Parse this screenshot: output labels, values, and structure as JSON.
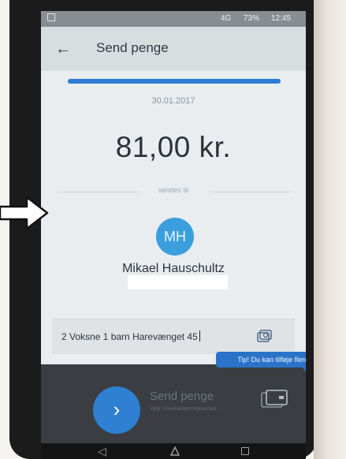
{
  "status_bar": {
    "network": "4G",
    "battery": "73%",
    "time": "12:45"
  },
  "header": {
    "title": "Send penge"
  },
  "transfer": {
    "progress": 1.0,
    "date": "30.01.2017",
    "amount": "81,00 kr.",
    "sent_to_label": "sendes til"
  },
  "recipient": {
    "initials": "MH",
    "name": "Mikael Hauschultz"
  },
  "message": {
    "text": "2 Voksne 1 barn Harevænget 45"
  },
  "tip": {
    "text": "Tip! Du kan tilføje flere kort"
  },
  "action": {
    "label": "Send penge",
    "sublabel": "Valgt: VISA/Dankort Mastercard ..."
  },
  "colors": {
    "accent": "#2f7fd2",
    "avatar": "#3a9fdc",
    "tip": "#2a73c8"
  }
}
